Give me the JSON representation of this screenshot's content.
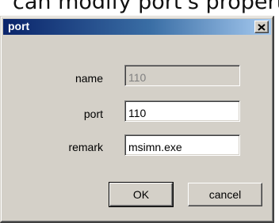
{
  "background_text": "can modify port's propert",
  "dialog": {
    "title": "port",
    "close_glyph": "✕",
    "fields": {
      "name": {
        "label": "name",
        "value": "110",
        "enabled": false
      },
      "port": {
        "label": "port",
        "value": "110",
        "enabled": true
      },
      "remark": {
        "label": "remark",
        "value": "msimn.exe",
        "enabled": true
      }
    },
    "buttons": {
      "ok": "OK",
      "cancel": "cancel"
    }
  },
  "colors": {
    "titlebar_start": "#0a246a",
    "titlebar_end": "#a6caf0",
    "face": "#d4d0c8"
  }
}
